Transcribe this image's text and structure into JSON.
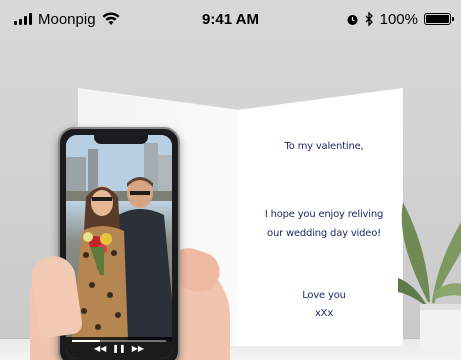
{
  "status_bar": {
    "carrier": "Moonpig",
    "time": "9:41 AM",
    "battery": "100%"
  },
  "card": {
    "greeting": "To my valentine,",
    "message_line1": "I hope you enjoy reliving",
    "message_line2": "our wedding day video!",
    "signoff_line1": "Love you",
    "signoff_line2": "xXx"
  },
  "video_player": {
    "progress": 0.3,
    "icons": [
      "rewind-icon",
      "pause-icon",
      "fast-forward-icon"
    ]
  },
  "colors": {
    "card_text": "#1c2a66",
    "background": "#d2d2d2"
  }
}
